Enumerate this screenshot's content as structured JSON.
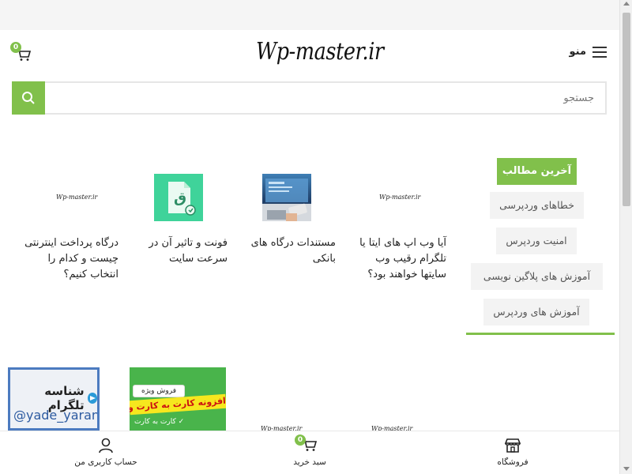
{
  "header": {
    "logo": "Wp-master.ir",
    "menu_label": "منو",
    "cart_count": "0"
  },
  "search": {
    "placeholder": "جستجو"
  },
  "sidebar": {
    "heading": "آخرین مطالب",
    "categories": [
      "خطاهای وردپرسی",
      "امنیت وردپرس",
      "آموزش های پلاگین نویسی",
      "آموزش های وردپرس"
    ]
  },
  "posts": [
    {
      "title_lines": [
        "آیا وب اپ های ایتا یا",
        "تلگرام رقیب وب",
        "سایتها خواهند بود؟"
      ],
      "thumb": "wp-master-logo"
    },
    {
      "title_lines": [
        "مستندات درگاه های",
        "بانکی"
      ],
      "thumb": "banking-card-laptop"
    },
    {
      "title_lines": [
        "فونت و تاثیر آن در",
        "سرعت سایت"
      ],
      "thumb": "font-file-icon"
    },
    {
      "title_lines": [
        "درگاه پرداخت اینترنتی",
        "چیست و کدام را",
        "انتخاب کنیم؟"
      ],
      "thumb": "wp-master-logo"
    }
  ],
  "thumb_logo_text": "Wp-master.ir",
  "products": {
    "telegram": {
      "title": "شناسه تلگرام",
      "handle": "@yade_yaran"
    },
    "woo": {
      "badge": "فروش ویژه",
      "stripe": "افزونه کارت به کارت ووکامرس",
      "sub": "✓ کارت به کارت"
    }
  },
  "bottom_nav": {
    "shop": "فروشگاه",
    "cart": "سبد خرید",
    "cart_count": "0",
    "account": "حساب کاربری من"
  },
  "colors": {
    "accent": "#81c04b",
    "category_bg": "#f3f3f3"
  }
}
